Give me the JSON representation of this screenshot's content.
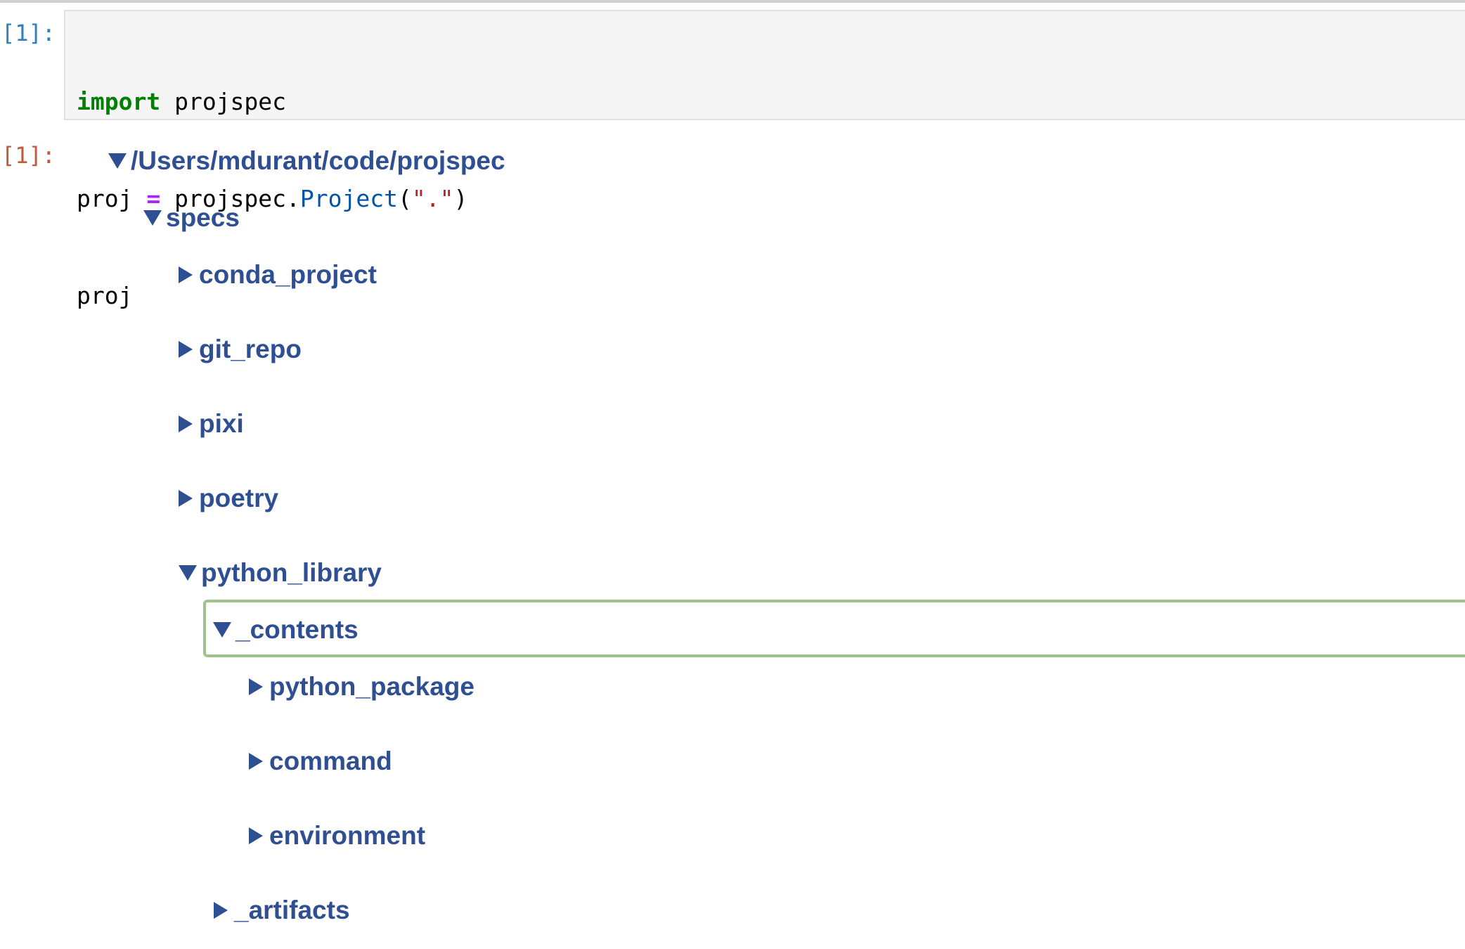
{
  "prompts": {
    "input": "[1]:",
    "output": "[1]:"
  },
  "code": {
    "line1": {
      "keyword": "import",
      "rest": " projspec"
    },
    "line2": {
      "var": "proj ",
      "op": "=",
      "mid": " projspec.",
      "name": "Project",
      "open": "(",
      "string": "\".\"",
      "close": ")"
    },
    "line3": {
      "text": "proj"
    }
  },
  "tree": {
    "root": {
      "label": "/Users/mdurant/code/projspec",
      "expanded": true
    },
    "specs": {
      "label": "specs",
      "expanded": true
    },
    "conda_project": {
      "label": "conda_project",
      "expanded": false
    },
    "git_repo": {
      "label": "git_repo",
      "expanded": false
    },
    "pixi": {
      "label": "pixi",
      "expanded": false
    },
    "poetry": {
      "label": "poetry",
      "expanded": false
    },
    "python_library": {
      "label": "python_library",
      "expanded": true
    },
    "contents": {
      "label": "_contents",
      "expanded": true,
      "focused": true
    },
    "python_package": {
      "label": "python_package",
      "expanded": false
    },
    "command": {
      "label": "command",
      "expanded": false
    },
    "environment": {
      "label": "environment",
      "expanded": false
    },
    "artifacts": {
      "label": "_artifacts",
      "expanded": false
    }
  },
  "colors": {
    "node_text": "#2f4f93",
    "focus_border": "#9cc48a",
    "in_prompt": "#307fc1",
    "out_prompt": "#bf5b3d"
  }
}
